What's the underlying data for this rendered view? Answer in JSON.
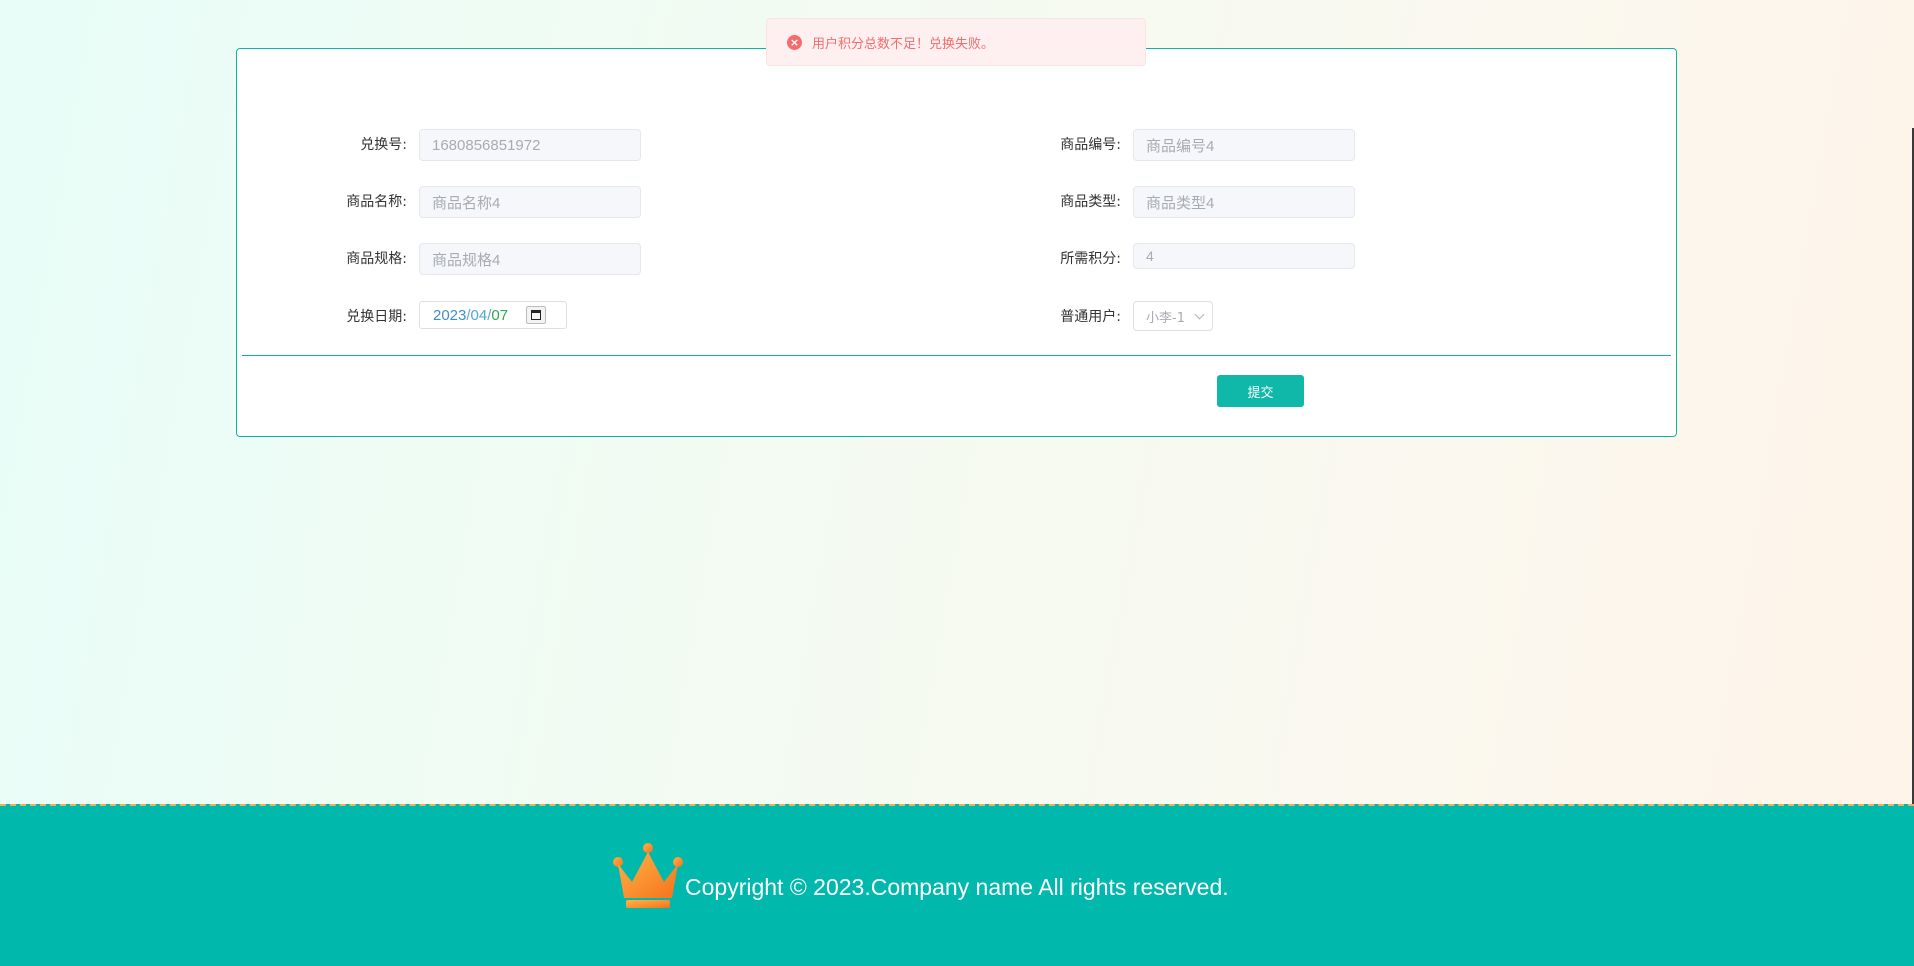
{
  "toast": {
    "icon": "error-circle-icon",
    "message": "用户积分总数不足！兑换失败。"
  },
  "form": {
    "fields": {
      "exchange_no": {
        "label": "兑换号:",
        "value": "1680856851972"
      },
      "product_code": {
        "label": "商品编号:",
        "value": "商品编号4"
      },
      "product_name": {
        "label": "商品名称:",
        "value": "商品名称4"
      },
      "product_type": {
        "label": "商品类型:",
        "value": "商品类型4"
      },
      "product_spec": {
        "label": "商品规格:",
        "value": "商品规格4"
      },
      "points_required": {
        "label": "所需积分:",
        "value": "4"
      },
      "exchange_date": {
        "label": "兑换日期:",
        "year": "2023",
        "sep": "/",
        "month": "04",
        "day": "07"
      },
      "user": {
        "label": "普通用户:",
        "value": "小李-1"
      }
    },
    "submit_label": "提交"
  },
  "footer": {
    "logo": "crown-icon",
    "copyright": "Copyright © 2023.Company name All rights reserved."
  },
  "colors": {
    "accent": "#10b8aa",
    "error": "#f56c6c",
    "footer_bg": "#00b8ab"
  }
}
